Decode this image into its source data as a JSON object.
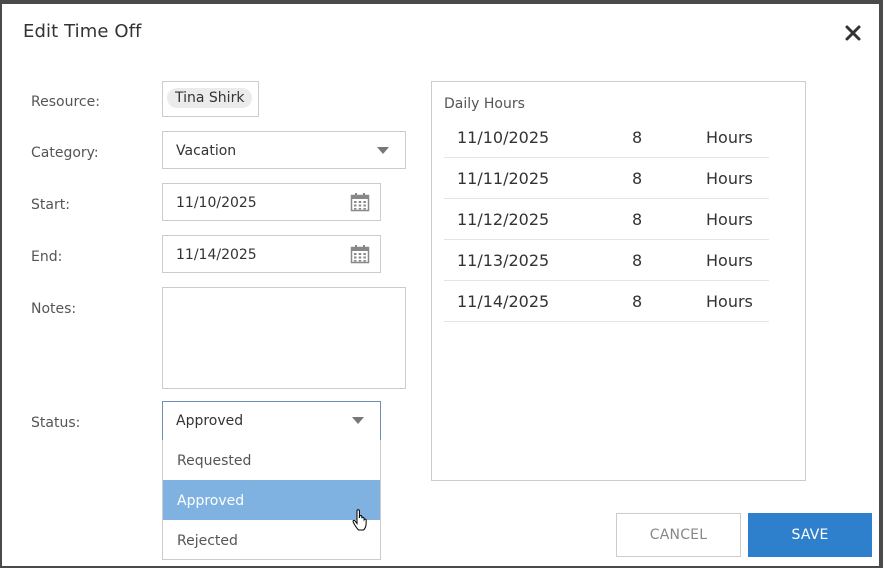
{
  "dialog": {
    "title": "Edit Time Off",
    "close_icon": "close-icon"
  },
  "form": {
    "resource": {
      "label": "Resource:",
      "value": "Tina Shirk"
    },
    "category": {
      "label": "Category:",
      "value": "Vacation"
    },
    "start": {
      "label": "Start:",
      "value": "11/10/2025"
    },
    "end": {
      "label": "End:",
      "value": "11/14/2025"
    },
    "notes": {
      "label": "Notes:",
      "value": ""
    },
    "status": {
      "label": "Status:",
      "value": "Approved",
      "options": [
        "Requested",
        "Approved",
        "Rejected"
      ],
      "selected": "Approved"
    }
  },
  "daily_hours": {
    "title": "Daily Hours",
    "rows": [
      {
        "date": "11/10/2025",
        "hours": "8",
        "unit": "Hours"
      },
      {
        "date": "11/11/2025",
        "hours": "8",
        "unit": "Hours"
      },
      {
        "date": "11/12/2025",
        "hours": "8",
        "unit": "Hours"
      },
      {
        "date": "11/13/2025",
        "hours": "8",
        "unit": "Hours"
      },
      {
        "date": "11/14/2025",
        "hours": "8",
        "unit": "Hours"
      }
    ]
  },
  "buttons": {
    "cancel": "CANCEL",
    "save": "SAVE"
  },
  "colors": {
    "accent": "#2e80cc",
    "selected_option": "#7fb2e0"
  }
}
